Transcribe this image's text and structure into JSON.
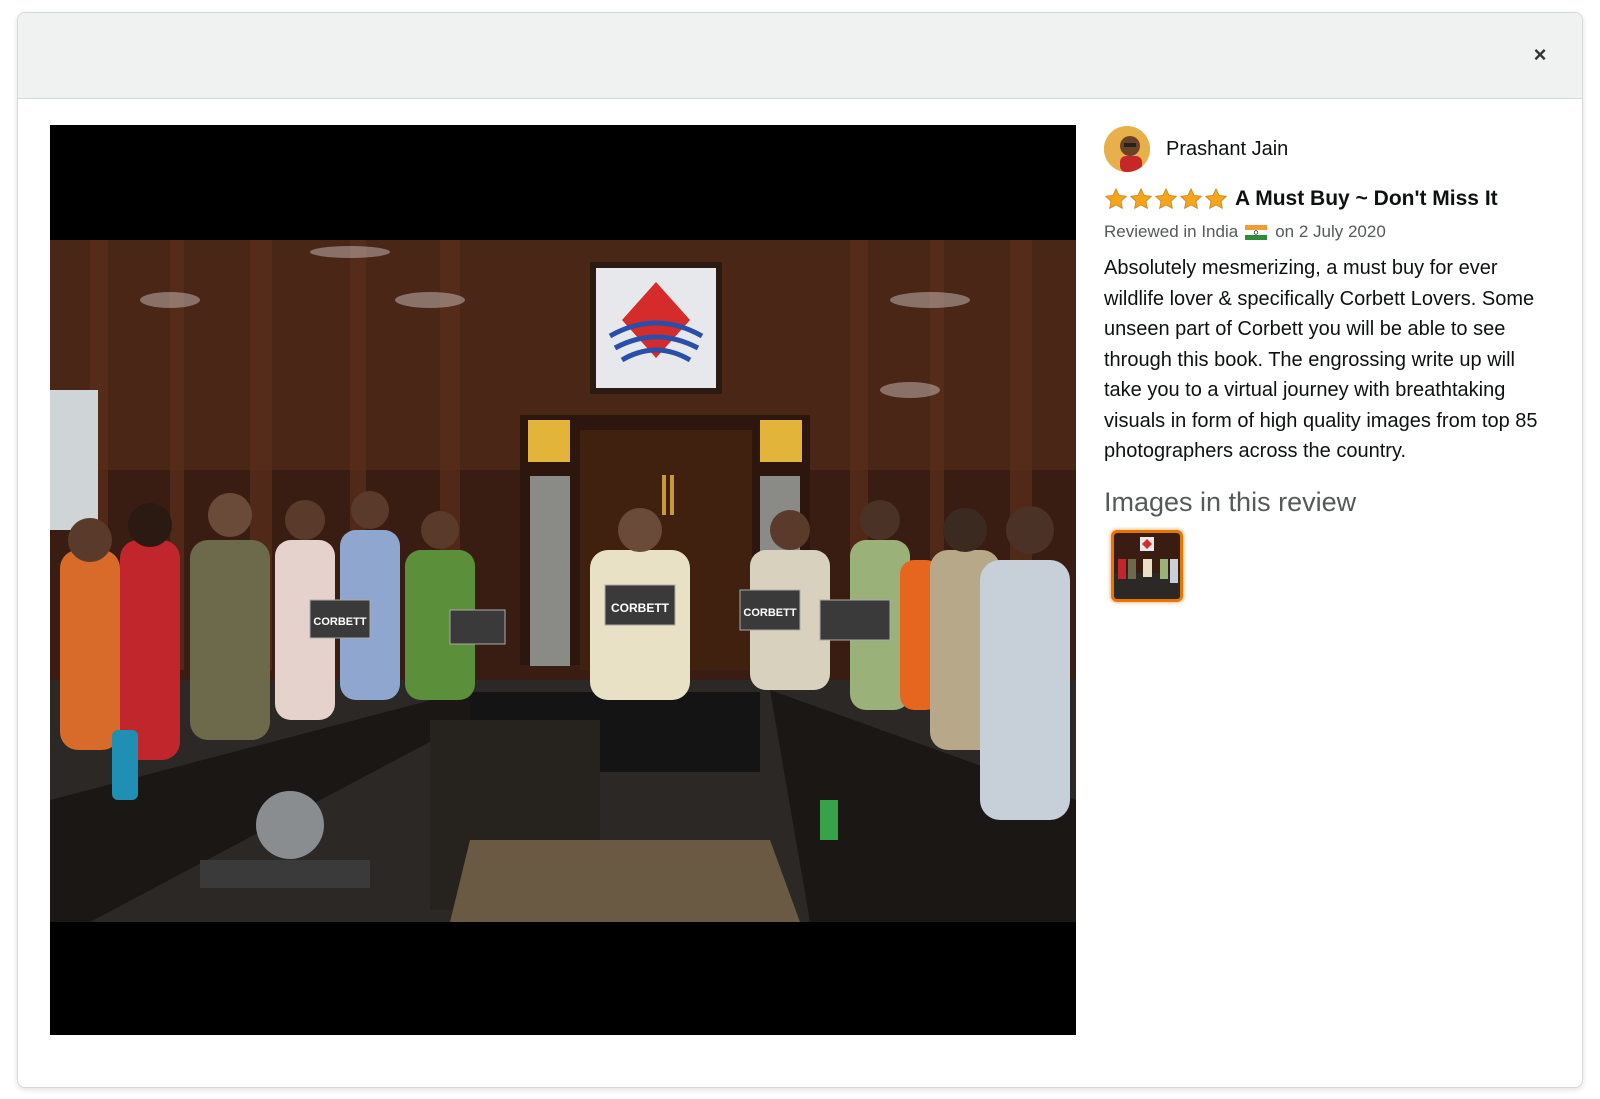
{
  "modal": {
    "close_label": "×"
  },
  "review": {
    "reviewer_name": "Prashant Jain",
    "rating": 5,
    "rating_max": 5,
    "title": "A Must Buy ~ Don't Miss It",
    "meta_prefix": "Reviewed in India",
    "meta_suffix": "on 2 July 2020",
    "body": "Absolutely mesmerizing, a must buy for ever wildlife lover & specifically Corbett Lovers. Some unseen part of Corbett you will be able to see through this book. The engrossing write up will take you to a virtual journey with breathtaking visuals in form of high quality images from top 85 photographers across the country.",
    "images_heading": "Images in this review"
  },
  "photo": {
    "book_label": "CORBETT"
  },
  "colors": {
    "star": "#f7a41d",
    "thumb_border": "#e77600",
    "header_bg": "#f0f2f2"
  }
}
